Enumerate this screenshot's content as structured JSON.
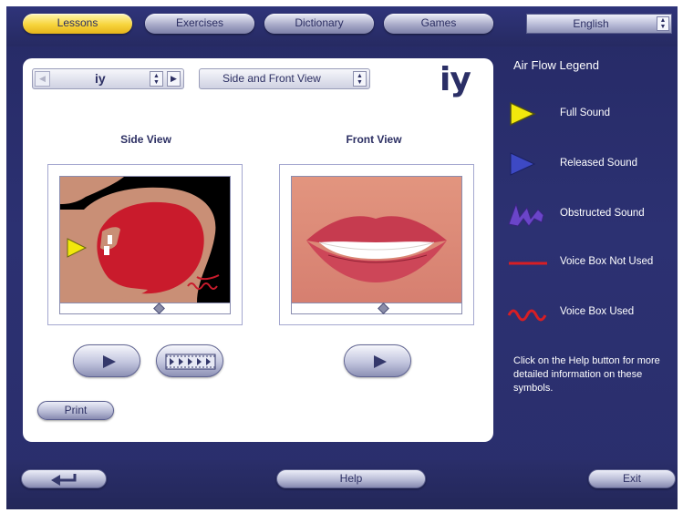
{
  "top_nav": {
    "tabs": [
      {
        "label": "Lessons",
        "active": true
      },
      {
        "label": "Exercises",
        "active": false
      },
      {
        "label": "Dictionary",
        "active": false
      },
      {
        "label": "Games",
        "active": false
      }
    ],
    "language": "English"
  },
  "panel": {
    "phoneme_selector": {
      "value": "iy"
    },
    "view_selector": {
      "value": "Side and Front View"
    },
    "phoneme_symbol": "iy",
    "side_view": {
      "title": "Side View"
    },
    "front_view": {
      "title": "Front View"
    },
    "print_label": "Print"
  },
  "legend": {
    "title": "Air Flow Legend",
    "items": [
      {
        "label": "Full Sound",
        "icon": "full-sound-arrow-icon"
      },
      {
        "label": "Released Sound",
        "icon": "released-sound-arrow-icon"
      },
      {
        "label": "Obstructed Sound",
        "icon": "obstructed-sound-icon"
      },
      {
        "label": "Voice Box Not Used",
        "icon": "voice-box-not-used-icon"
      },
      {
        "label": "Voice Box Used",
        "icon": "voice-box-used-icon"
      }
    ],
    "help_text": "Click on the Help button for more detailed information on these symbols."
  },
  "bottom_bar": {
    "help_label": "Help",
    "exit_label": "Exit"
  },
  "colors": {
    "background": "#2a2e6c",
    "active_tab": "#f7d43c",
    "full_sound": "#f2e80c",
    "released_sound": "#3d49c4",
    "obstructed_sound": "#6a45c9",
    "voice_box": "#d81e24"
  }
}
